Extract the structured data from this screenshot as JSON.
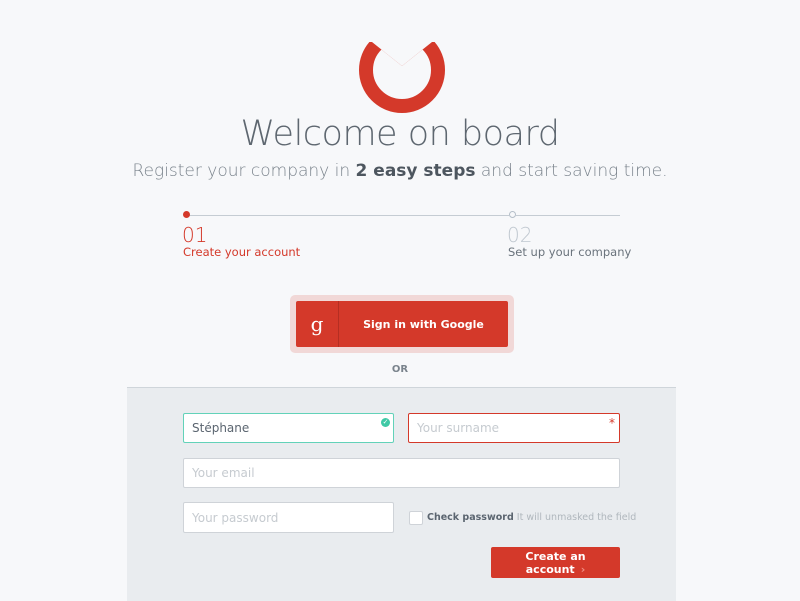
{
  "brand": {
    "color": "#d4392a",
    "logo": "envelope-ring-logo"
  },
  "header": {
    "title": "Welcome on board",
    "subtitle_pre": "Register your company in ",
    "subtitle_bold": "2 easy steps",
    "subtitle_post": " and start saving time."
  },
  "steps": [
    {
      "number": "01",
      "label": "Create your account",
      "active": true
    },
    {
      "number": "02",
      "label": "Set up your company",
      "active": false
    }
  ],
  "google": {
    "icon": "g",
    "label": "Sign in with Google"
  },
  "or_label": "OR",
  "form": {
    "name_value": "Stéphane",
    "surname_placeholder": "Your surname",
    "email_placeholder": "Your email",
    "password_placeholder": "Your password",
    "required_mark": "*",
    "check_label": "Check password",
    "check_hint": " It will unmasked the field",
    "submit_label": "Create an account",
    "submit_arrow": "›"
  }
}
